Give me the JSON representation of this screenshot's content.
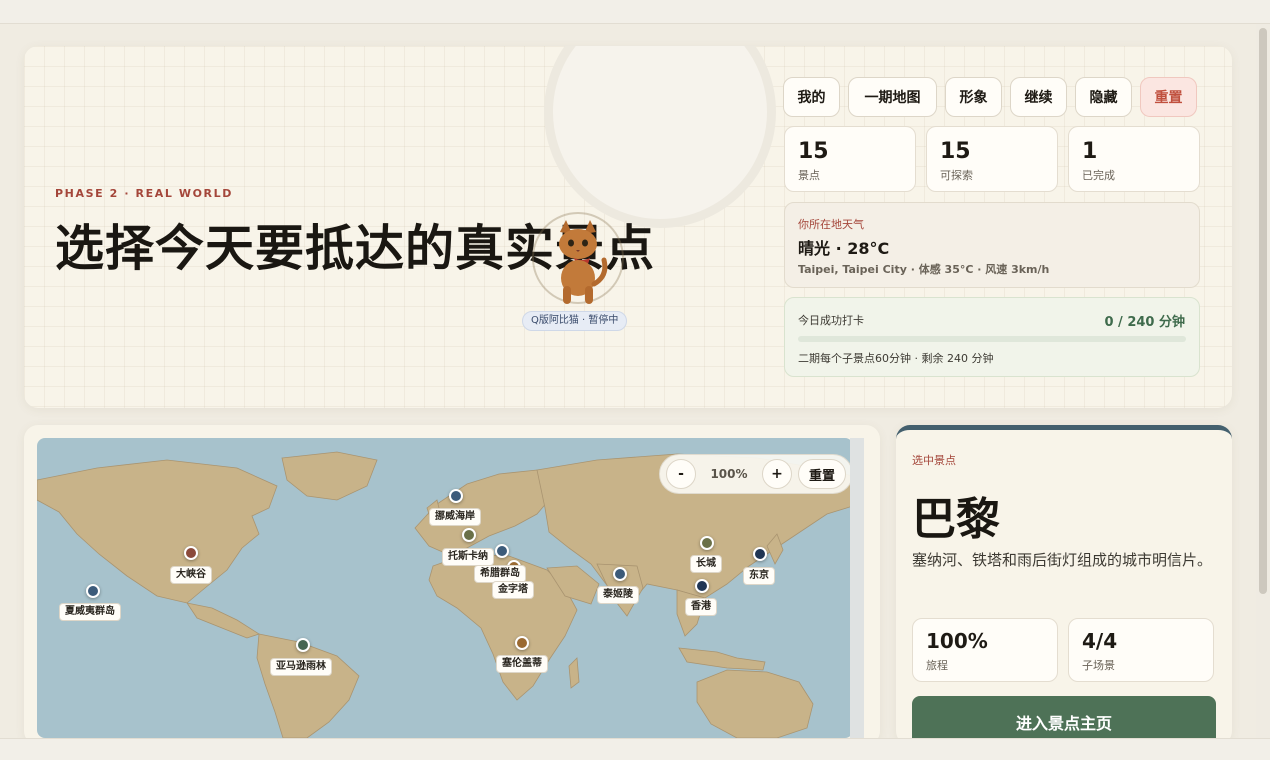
{
  "hero": {
    "phase": "PHASE 2 · REAL WORLD",
    "title": "选择今天要抵达的真实景点",
    "cat_status": "Q版阿比猫 · 暂停中"
  },
  "toolbar": {
    "buttons": [
      "我的",
      "一期地图",
      "形象",
      "继续",
      "隐藏"
    ],
    "reset_label": "重置"
  },
  "stats": [
    {
      "value": "15",
      "label": "景点"
    },
    {
      "value": "15",
      "label": "可探索"
    },
    {
      "value": "1",
      "label": "已完成"
    }
  ],
  "weather": {
    "label": "你所在地天气",
    "condition": "晴光 · 28°C",
    "detail": "Taipei, Taipei City · 体感 35°C · 风速 3km/h"
  },
  "checkin": {
    "label": "今日成功打卡",
    "value": "0 / 240 分钟",
    "progress": 0,
    "detail": "二期每个子景点60分钟 · 剩余 240 分钟"
  },
  "map": {
    "zoom_out": "-",
    "zoom_level": "100%",
    "zoom_in": "+",
    "reset": "重置",
    "pin_colors": {
      "red": "#8b4a3b",
      "blue": "#3c5b7a",
      "olive": "#6a7048",
      "orange": "#9a6a32",
      "green": "#466652",
      "navy": "#1f3554"
    },
    "places": [
      {
        "id": "norway",
        "name": "挪威海岸",
        "color": "blue"
      },
      {
        "id": "tasmania-hidden",
        "name": "托斯卡纳",
        "color": "olive"
      },
      {
        "id": "greece",
        "name": "希腊群岛",
        "color": "blue"
      },
      {
        "id": "pyramid",
        "name": "金字塔",
        "color": "orange"
      },
      {
        "id": "grandcanyon",
        "name": "大峡谷",
        "color": "red"
      },
      {
        "id": "hawaii",
        "name": "夏威夷群岛",
        "color": "blue"
      },
      {
        "id": "amazon",
        "name": "亚马逊雨林",
        "color": "green"
      },
      {
        "id": "serengeti",
        "name": "塞伦盖蒂",
        "color": "orange"
      },
      {
        "id": "tajmahal",
        "name": "泰姬陵",
        "color": "blue"
      },
      {
        "id": "greatwall",
        "name": "长城",
        "color": "olive"
      },
      {
        "id": "tokyo",
        "name": "东京",
        "color": "navy"
      },
      {
        "id": "hongkong",
        "name": "香港",
        "color": "navy"
      }
    ]
  },
  "detail": {
    "label": "选中景点",
    "name": "巴黎",
    "description": "塞纳河、铁塔和雨后街灯组成的城市明信片。",
    "stats": [
      {
        "value": "100%",
        "label": "旅程"
      },
      {
        "value": "4/4",
        "label": "子场景"
      }
    ],
    "enter_label": "进入景点主页"
  }
}
